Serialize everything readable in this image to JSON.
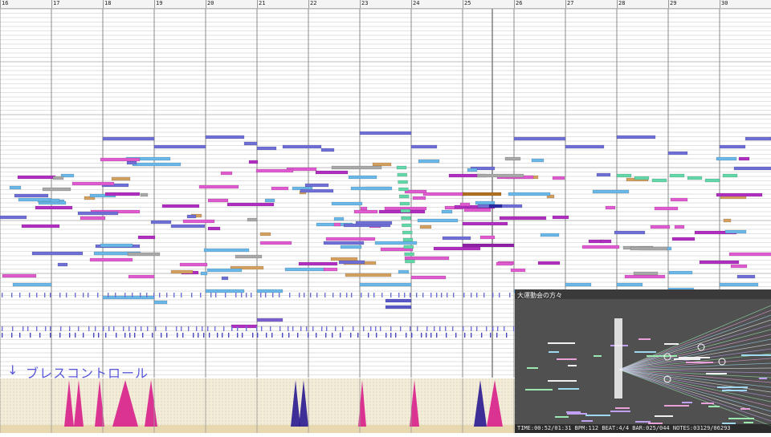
{
  "ruler": {
    "bars": [
      "16",
      "17",
      "18",
      "19",
      "20",
      "21",
      "22",
      "23",
      "24",
      "25",
      "26",
      "27",
      "28",
      "29",
      "30"
    ]
  },
  "breath_control": {
    "arrow": "↓",
    "label": "ブレスコントロール"
  },
  "video_preview": {
    "title": "大運動会の方々",
    "status": "TIME:00:52/01:31  BPM:112  BEAT:4/4  BAR:025/044  NOTES:03129/06293"
  },
  "colors": {
    "background": "#ffffff",
    "grid_line": "#cfcfcf",
    "bar_line": "#8a8a8a",
    "note_purple": "#6f6fd8",
    "note_pink": "#e05ad0",
    "note_magenta": "#b02fc0",
    "note_blue": "#6ab8e8",
    "note_tan": "#d4a060",
    "note_gray": "#a8a8a8",
    "note_green": "#62d8a8",
    "note_brown": "#b07020",
    "breath_lane_bg": "#f2ecd8",
    "breath_peak_pink": "#d81f8a",
    "breath_peak_navy": "#2a1a90",
    "label_color": "#5a58d8"
  }
}
